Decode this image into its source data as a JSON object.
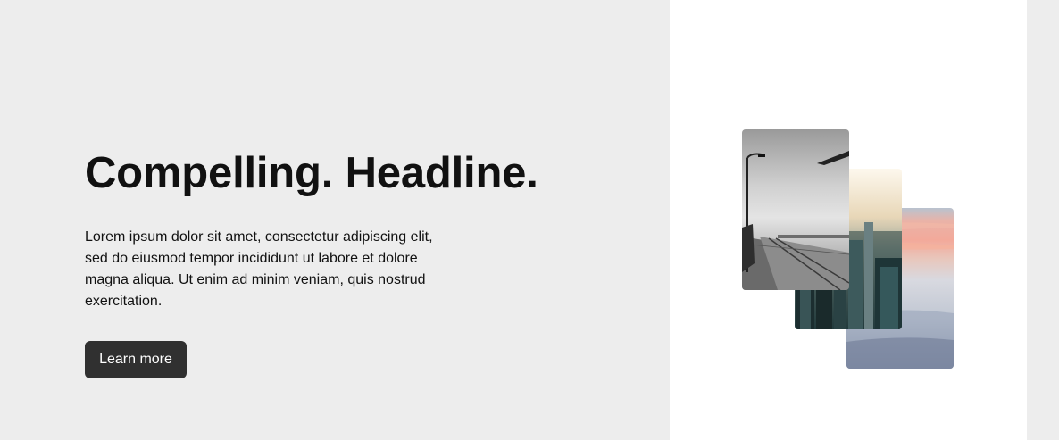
{
  "hero": {
    "headline": "Compelling. Headline.",
    "body": "Lorem ipsum dolor sit amet, consectetur adipiscing elit, sed do eiusmod tempor incididunt ut labore et dolore magna aliqua. Ut enim ad minim veniam, quis nostrud exercitation.",
    "cta_label": "Learn more"
  },
  "colors": {
    "page_background": "#ededed",
    "panel_background": "#ffffff",
    "button_background": "#303030",
    "button_text": "#ffffff",
    "text": "#111111"
  },
  "images": [
    {
      "subject": "black-and-white pier with street lamp"
    },
    {
      "subject": "city skyscrapers aerial view"
    },
    {
      "subject": "sunset sky above clouds"
    }
  ]
}
